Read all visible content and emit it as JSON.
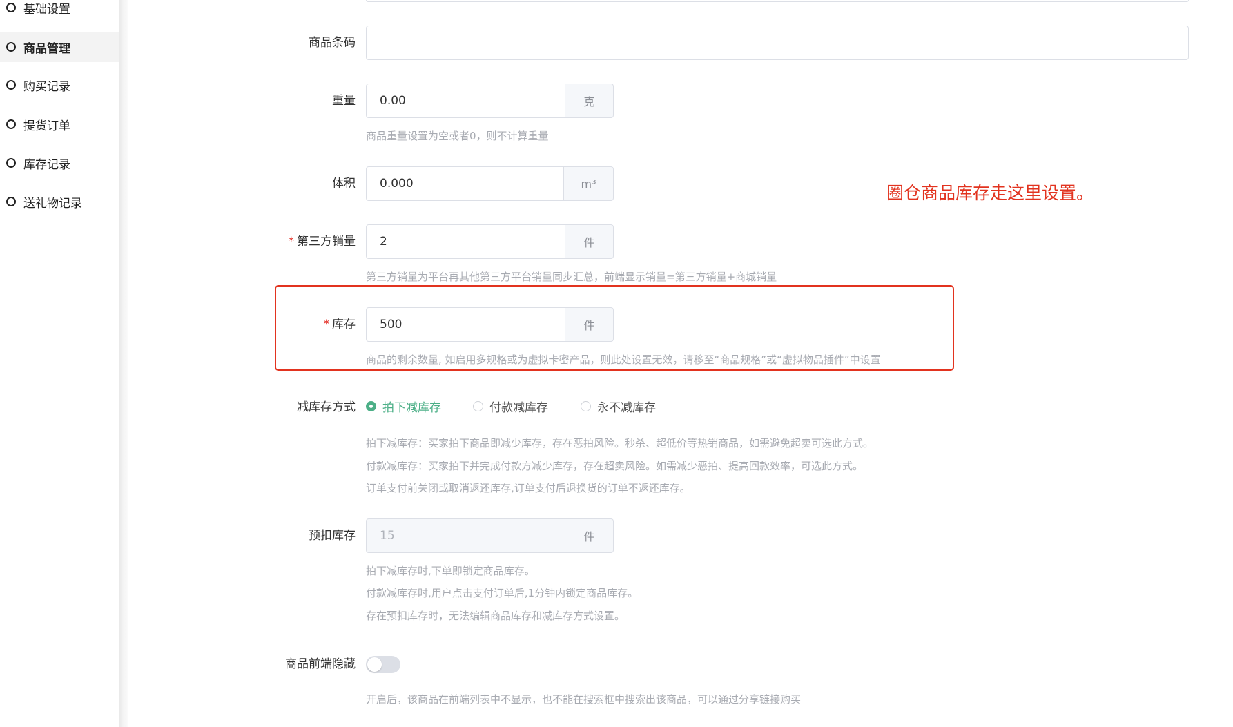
{
  "sidebar": {
    "items": [
      {
        "label": "基础设置"
      },
      {
        "label": "商品管理"
      },
      {
        "label": "购买记录"
      },
      {
        "label": "提货订单"
      },
      {
        "label": "库存记录"
      },
      {
        "label": "送礼物记录"
      }
    ],
    "active_index": 1
  },
  "form": {
    "barcode": {
      "label": "商品条码",
      "value": ""
    },
    "weight": {
      "label": "重量",
      "value": "0.00",
      "unit": "克",
      "help": "商品重量设置为空或者0，则不计算重量"
    },
    "volume": {
      "label": "体积",
      "value": "0.000",
      "unit": "m³"
    },
    "third_party_sales": {
      "label": "第三方销量",
      "required_mark": "*",
      "value": "2",
      "unit": "件",
      "help": "第三方销量为平台再其他第三方平台销量同步汇总，前端显示销量=第三方销量+商城销量"
    },
    "stock": {
      "label": "库存",
      "required_mark": "*",
      "value": "500",
      "unit": "件",
      "help": "商品的剩余数量, 如启用多规格或为虚拟卡密产品，则此处设置无效，请移至“商品规格”或“虚拟物品插件”中设置"
    },
    "stock_reduce_mode": {
      "label": "减库存方式",
      "options": [
        "拍下减库存",
        "付款减库存",
        "永不减库存"
      ],
      "selected": "拍下减库存",
      "help_lines": [
        "拍下减库存：买家拍下商品即减少库存，存在恶拍风险。秒杀、超低价等热销商品，如需避免超卖可选此方式。",
        "付款减库存：买家拍下并完成付款方减少库存，存在超卖风险。如需减少恶拍、提高回款效率，可选此方式。",
        "订单支付前关闭或取消返还库存,订单支付后退换货的订单不返还库存。"
      ]
    },
    "pre_deduct_stock": {
      "label": "预扣库存",
      "value": "15",
      "unit": "件",
      "help_lines": [
        "拍下减库存时,下单即锁定商品库存。",
        "付款减库存时,用户点击支付订单后,1分钟内锁定商品库存。",
        "存在预扣库存时，无法编辑商品库存和减库存方式设置。"
      ]
    },
    "hide_frontend": {
      "label": "商品前端隐藏",
      "enabled": false,
      "help": "开启后，该商品在前端列表中不显示，也不能在搜索框中搜索出该商品，可以通过分享链接购买"
    }
  },
  "annotation": {
    "text": "圈仓商品库存走这里设置。",
    "color": "#e2331f"
  },
  "colors": {
    "accent": "#4caf87",
    "required": "#e2231a",
    "border": "#dcdfe6",
    "help_text": "#a8abb2"
  }
}
